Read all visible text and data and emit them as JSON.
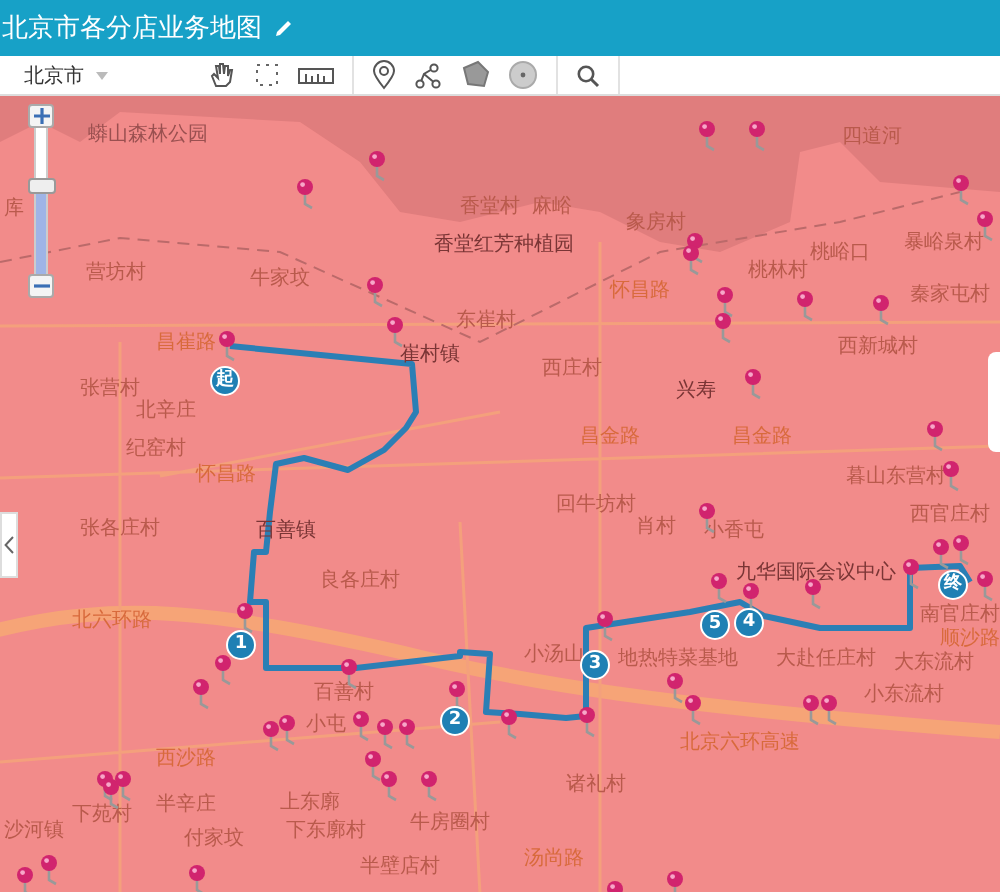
{
  "header": {
    "title": "北京市各分店业务地图"
  },
  "toolbar": {
    "city": "北京市"
  },
  "map": {
    "zoom": {
      "level": 0.6
    },
    "labels": [
      {
        "text": "蟒山森林公园",
        "kind": "poi"
      },
      {
        "text": "库",
        "kind": "place"
      },
      {
        "text": "香堂村",
        "kind": "place"
      },
      {
        "text": "香堂红芳种植园",
        "kind": "major"
      },
      {
        "text": "营坊村",
        "kind": "place"
      },
      {
        "text": "牛家坟",
        "kind": "place"
      },
      {
        "text": "昌崔路",
        "kind": "road"
      },
      {
        "text": "东崔村",
        "kind": "place"
      },
      {
        "text": "崔村镇",
        "kind": "major"
      },
      {
        "text": "张营村",
        "kind": "place"
      },
      {
        "text": "北辛庄",
        "kind": "place"
      },
      {
        "text": "纪窑村",
        "kind": "place"
      },
      {
        "text": "怀昌路",
        "kind": "road"
      },
      {
        "text": "麻峪",
        "kind": "place"
      },
      {
        "text": "象房村",
        "kind": "place"
      },
      {
        "text": "桃峪口",
        "kind": "place"
      },
      {
        "text": "桃林村",
        "kind": "place"
      },
      {
        "text": "四道河",
        "kind": "place"
      },
      {
        "text": "暴峪泉村",
        "kind": "place"
      },
      {
        "text": "怀昌路",
        "kind": "road"
      },
      {
        "text": "秦家屯村",
        "kind": "place"
      },
      {
        "text": "西庄村",
        "kind": "place"
      },
      {
        "text": "兴寿",
        "kind": "major"
      },
      {
        "text": "西新城村",
        "kind": "place"
      },
      {
        "text": "昌金路",
        "kind": "road"
      },
      {
        "text": "昌金路",
        "kind": "road"
      },
      {
        "text": "暮山东营村",
        "kind": "place"
      },
      {
        "text": "张各庄村",
        "kind": "place"
      },
      {
        "text": "百善镇",
        "kind": "major"
      },
      {
        "text": "良各庄村",
        "kind": "place"
      },
      {
        "text": "北六环路",
        "kind": "road"
      },
      {
        "text": "百善村",
        "kind": "place"
      },
      {
        "text": "小屯",
        "kind": "place"
      },
      {
        "text": "西沙路",
        "kind": "road"
      },
      {
        "text": "下苑村",
        "kind": "place"
      },
      {
        "text": "半辛庄",
        "kind": "place"
      },
      {
        "text": "上东廓",
        "kind": "place"
      },
      {
        "text": "沙河镇",
        "kind": "place"
      },
      {
        "text": "付家坟",
        "kind": "place"
      },
      {
        "text": "下东廓村",
        "kind": "place"
      },
      {
        "text": "牛房圈村",
        "kind": "place"
      },
      {
        "text": "半壁店村",
        "kind": "place"
      },
      {
        "text": "回牛坊村",
        "kind": "place"
      },
      {
        "text": "肖村",
        "kind": "place"
      },
      {
        "text": "小香屯",
        "kind": "place"
      },
      {
        "text": "九华国际会议中心",
        "kind": "major"
      },
      {
        "text": "小汤山",
        "kind": "place"
      },
      {
        "text": "地热特菜基地",
        "kind": "place"
      },
      {
        "text": "大赴任庄村",
        "kind": "place"
      },
      {
        "text": "大东流村",
        "kind": "place"
      },
      {
        "text": "小东流村",
        "kind": "place"
      },
      {
        "text": "西官庄村",
        "kind": "place"
      },
      {
        "text": "南官庄村",
        "kind": "place"
      },
      {
        "text": "顺沙路",
        "kind": "road"
      },
      {
        "text": "北京六环高速",
        "kind": "road"
      },
      {
        "text": "诸礼村",
        "kind": "place"
      },
      {
        "text": "汤尚路",
        "kind": "road"
      }
    ],
    "route_markers": [
      {
        "text": "起"
      },
      {
        "text": "1"
      },
      {
        "text": "2"
      },
      {
        "text": "3"
      },
      {
        "text": "5"
      },
      {
        "text": "4"
      },
      {
        "text": "终"
      }
    ]
  }
}
